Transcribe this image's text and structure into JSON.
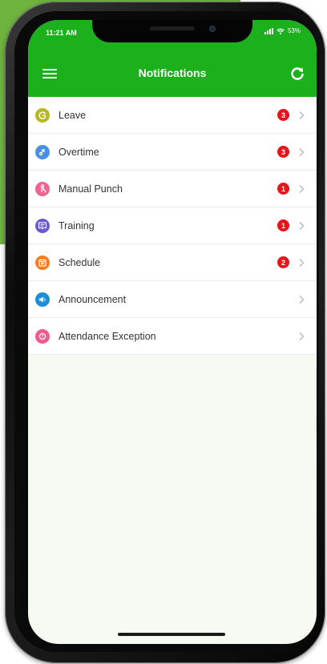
{
  "status_bar": {
    "time": "11:21 AM",
    "battery": "53%"
  },
  "header": {
    "title": "Notifications"
  },
  "colors": {
    "header": "#1cb01c",
    "badge": "#e8141c",
    "background_accent": "#6fb33f"
  },
  "items": [
    {
      "label": "Leave",
      "badge": "3",
      "icon": "leave-icon",
      "color": "#b5b81f"
    },
    {
      "label": "Overtime",
      "badge": "3",
      "icon": "overtime-icon",
      "color": "#4a90e2"
    },
    {
      "label": "Manual Punch",
      "badge": "1",
      "icon": "manual-punch-icon",
      "color": "#f06292"
    },
    {
      "label": "Training",
      "badge": "1",
      "icon": "training-icon",
      "color": "#6a5acd"
    },
    {
      "label": "Schedule",
      "badge": "2",
      "icon": "schedule-icon",
      "color": "#f57c20"
    },
    {
      "label": "Announcement",
      "badge": "",
      "icon": "announcement-icon",
      "color": "#1e8fd6"
    },
    {
      "label": "Attendance Exception",
      "badge": "",
      "icon": "attendance-exception-icon",
      "color": "#ef5b8e"
    }
  ]
}
